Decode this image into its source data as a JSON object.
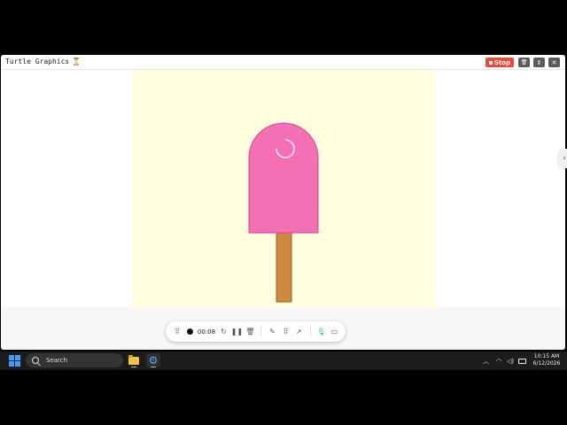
{
  "window": {
    "title": "Turtle Graphics",
    "title_icon": "⏳",
    "stop_label": "Stop",
    "window_buttons": {
      "trash": "🗑",
      "restore": "⇕",
      "close": "✕"
    }
  },
  "canvas": {
    "background": "#ffffe0",
    "popsicle_color": "#f46fb4",
    "popsicle_outline": "#d14d93",
    "stick_color": "#cd8a43",
    "stick_outline": "#9c6128"
  },
  "recorder": {
    "elapsed": "00:08",
    "icons": [
      "drag-handle-icon",
      "record-dot-icon",
      "restart-icon",
      "pause-icon",
      "trash-icon",
      "pen-icon",
      "grid-icon",
      "pointer-icon",
      "microphone-icon",
      "camera-icon"
    ]
  },
  "taskbar": {
    "search_label": "Search",
    "time": "10:15 AM",
    "date": "6/12/2026"
  },
  "colors": {
    "stop_red": "#e74c3c",
    "taskbar": "#1c1c1c",
    "windows_blue": "#3aa0ff",
    "mic_green": "#2ecc71"
  }
}
